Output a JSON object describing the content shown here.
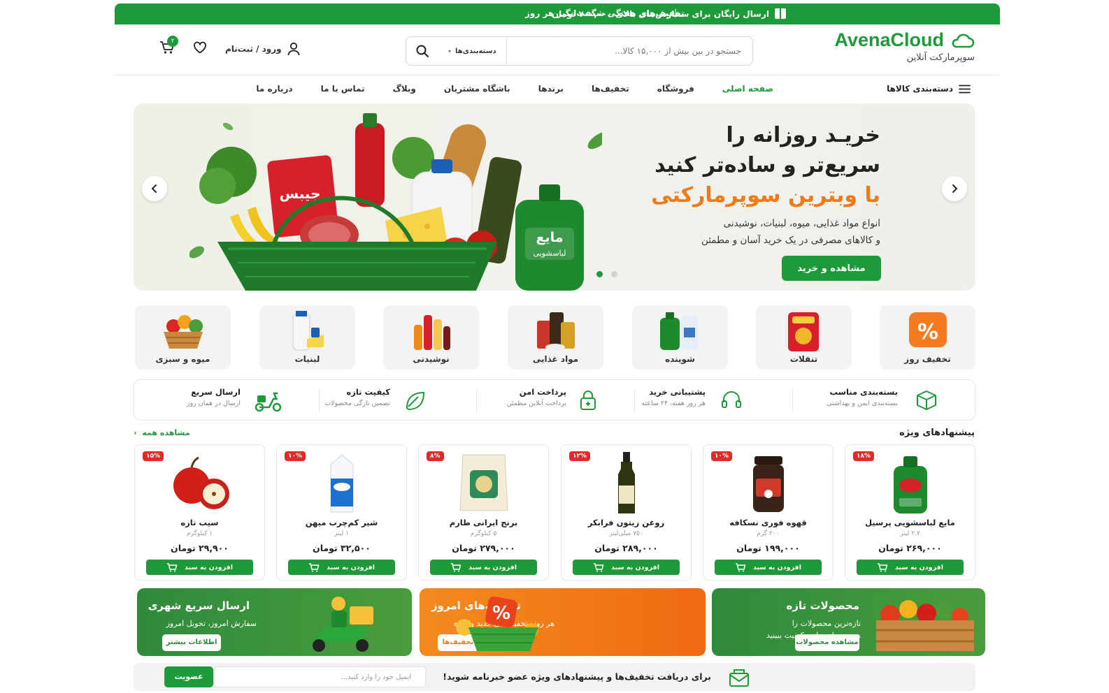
{
  "topbar": {
    "free_shipping": "ارسال رایگان برای سفارش‌های بالای ۷۰۰,۰۰۰ تومان",
    "separator": "|",
    "weekly_deals": "تخفیف‌های هفتگی شگفت‌انگیز هر روز"
  },
  "header": {
    "brand": "AvenaCloud",
    "tagline": "سوپرمارکت آنلاین",
    "search_placeholder": "جستجو در بین بیش از ۱۵,۰۰۰ کالا...",
    "search_category": "دسته‌بندی‌ها",
    "cart_count": "۲",
    "login_label": "ورود / ثبت‌نام"
  },
  "nav": {
    "categories_label": "دسته‌بندی کالاها",
    "items": [
      {
        "label": "صفحه اصلی"
      },
      {
        "label": "فروشگاه"
      },
      {
        "label": "تخفیف‌ها"
      },
      {
        "label": "برندها"
      },
      {
        "label": "باشگاه مشتریان"
      },
      {
        "label": "وبلاگ"
      },
      {
        "label": "تماس با ما"
      },
      {
        "label": "درباره ما"
      }
    ]
  },
  "hero": {
    "line1": "خریـد روزانه را",
    "line2": "سریع‌تر و ساده‌تر کنید",
    "line3": "با وبترین سوپرمارکتی",
    "desc1": "انواع مواد غذایی، میوه، لبنیات، نوشیدنی",
    "desc2": "و کالاهای مصرفی در یک خرید آسان و مطمئن",
    "cta": "مشاهده و خرید",
    "chips_label": "جیبس",
    "detergent_label": "مایع",
    "detergent_sub": "لباسشویی"
  },
  "categories": [
    {
      "label": "تخفیف روز"
    },
    {
      "label": "تنقلات"
    },
    {
      "label": "شوینده"
    },
    {
      "label": "مواد غذایی"
    },
    {
      "label": "نوشیدنی"
    },
    {
      "label": "لبنیات"
    },
    {
      "label": "میوه و سبزی"
    }
  ],
  "features": [
    {
      "title": "بسته‌بندی مناسب",
      "sub": "بسته‌بندی ایمن و بهداشتی"
    },
    {
      "title": "پشتیبانی خرید",
      "sub": "هر روز هفته، ۲۴ ساعته"
    },
    {
      "title": "پرداخت امن",
      "sub": "پرداخت آنلاین مطمئن"
    },
    {
      "title": "کیفیت تازه",
      "sub": "تضمین تازگی محصولات"
    },
    {
      "title": "ارسال سریع",
      "sub": "ارسال در همان روز"
    }
  ],
  "offers": {
    "title": "پیشنهادهای ویژه",
    "see_all": "مشاهده همه",
    "add_label": "افزودن به سبد",
    "products": [
      {
        "name": "مایع لباسشویی پرسیل",
        "weight": "۲.۷ لیتر",
        "price": "۲۶۹,۰۰۰ تومان",
        "discount": "۱۸%"
      },
      {
        "name": "قهوه فوری نسکافه",
        "weight": "۲۰۰ گرم",
        "price": "۱۹۹,۰۰۰ تومان",
        "discount": "۱۰%"
      },
      {
        "name": "روغن زیتون فرابکر",
        "weight": "۷۵۰ میلی‌لیتر",
        "price": "۲۸۹,۰۰۰ تومان",
        "discount": "۱۲%"
      },
      {
        "name": "برنج ایرانی طارم",
        "weight": "۵ کیلوگرم",
        "price": "۲۷۹,۰۰۰ تومان",
        "discount": "۸%"
      },
      {
        "name": "شیر کم‌چرب میهن",
        "weight": "۱ لیتر",
        "price": "۳۲,۵۰۰ تومان",
        "discount": "۱۰%"
      },
      {
        "name": "سیب تازه",
        "weight": "۱ کیلوگرم",
        "price": "۲۹,۹۰۰ تومان",
        "discount": "۱۵%"
      }
    ]
  },
  "promos": [
    {
      "title": "محصولات تازه",
      "sub1": "تازه‌ترین محصولات را",
      "sub2": "هر روز با ضمانت کیفیت ببینید",
      "button": "مشاهده محصولات"
    },
    {
      "title": "تخفیف‌های امروز",
      "sub1": "هر روز، تخفیف‌های جدید و ویژه",
      "button": "مشاهده تخفیف‌ها"
    },
    {
      "title": "ارسال سریع شهری",
      "sub1": "سفارش امروز، تحویل امروز",
      "button": "اطلاعات بیشتر"
    }
  ],
  "newsletter": {
    "text": "برای دریافت تخفیف‌ها و پیشنهادهای ویژه عضو خبرنامه شوید!",
    "placeholder": "ایمیل خود را وارد کنید...",
    "button": "عضویت"
  },
  "colors": {
    "primary": "#1e9a3a",
    "accent": "#f07a1a",
    "sale": "#e02a2a"
  }
}
